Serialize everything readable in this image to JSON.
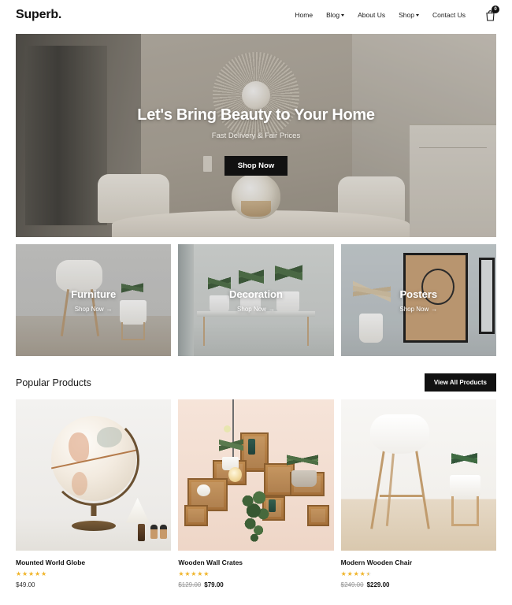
{
  "header": {
    "logo": "Superb.",
    "nav": [
      {
        "label": "Home",
        "has_dropdown": false
      },
      {
        "label": "Blog",
        "has_dropdown": true
      },
      {
        "label": "About Us",
        "has_dropdown": false
      },
      {
        "label": "Shop",
        "has_dropdown": true
      },
      {
        "label": "Contact Us",
        "has_dropdown": false
      }
    ],
    "cart_count": "0"
  },
  "hero": {
    "title": "Let's Bring Beauty to Your Home",
    "subtitle": "Fast Delivery & Fair Prices",
    "button": "Shop Now"
  },
  "categories": [
    {
      "title": "Furniture",
      "link": "Shop Now",
      "arrow": "→"
    },
    {
      "title": "Decoration",
      "link": "Shop Now",
      "arrow": "→"
    },
    {
      "title": "Posters",
      "link": "Shop Now",
      "arrow": "→"
    }
  ],
  "popular": {
    "title": "Popular Products",
    "view_all": "View All Products",
    "products": [
      {
        "name": "Mounted World Globe",
        "rating": 5,
        "price": "$49.00",
        "old_price": ""
      },
      {
        "name": "Wooden Wall Crates",
        "rating": 5,
        "price": "$79.00",
        "old_price": "$129.00"
      },
      {
        "name": "Modern Wooden Chair",
        "rating": 4.5,
        "price": "$229.00",
        "old_price": "$249.00"
      }
    ]
  },
  "colors": {
    "accent_dark": "#111111",
    "star": "#f0b429",
    "text": "#1a1a1a",
    "muted": "#9a9a9a"
  }
}
